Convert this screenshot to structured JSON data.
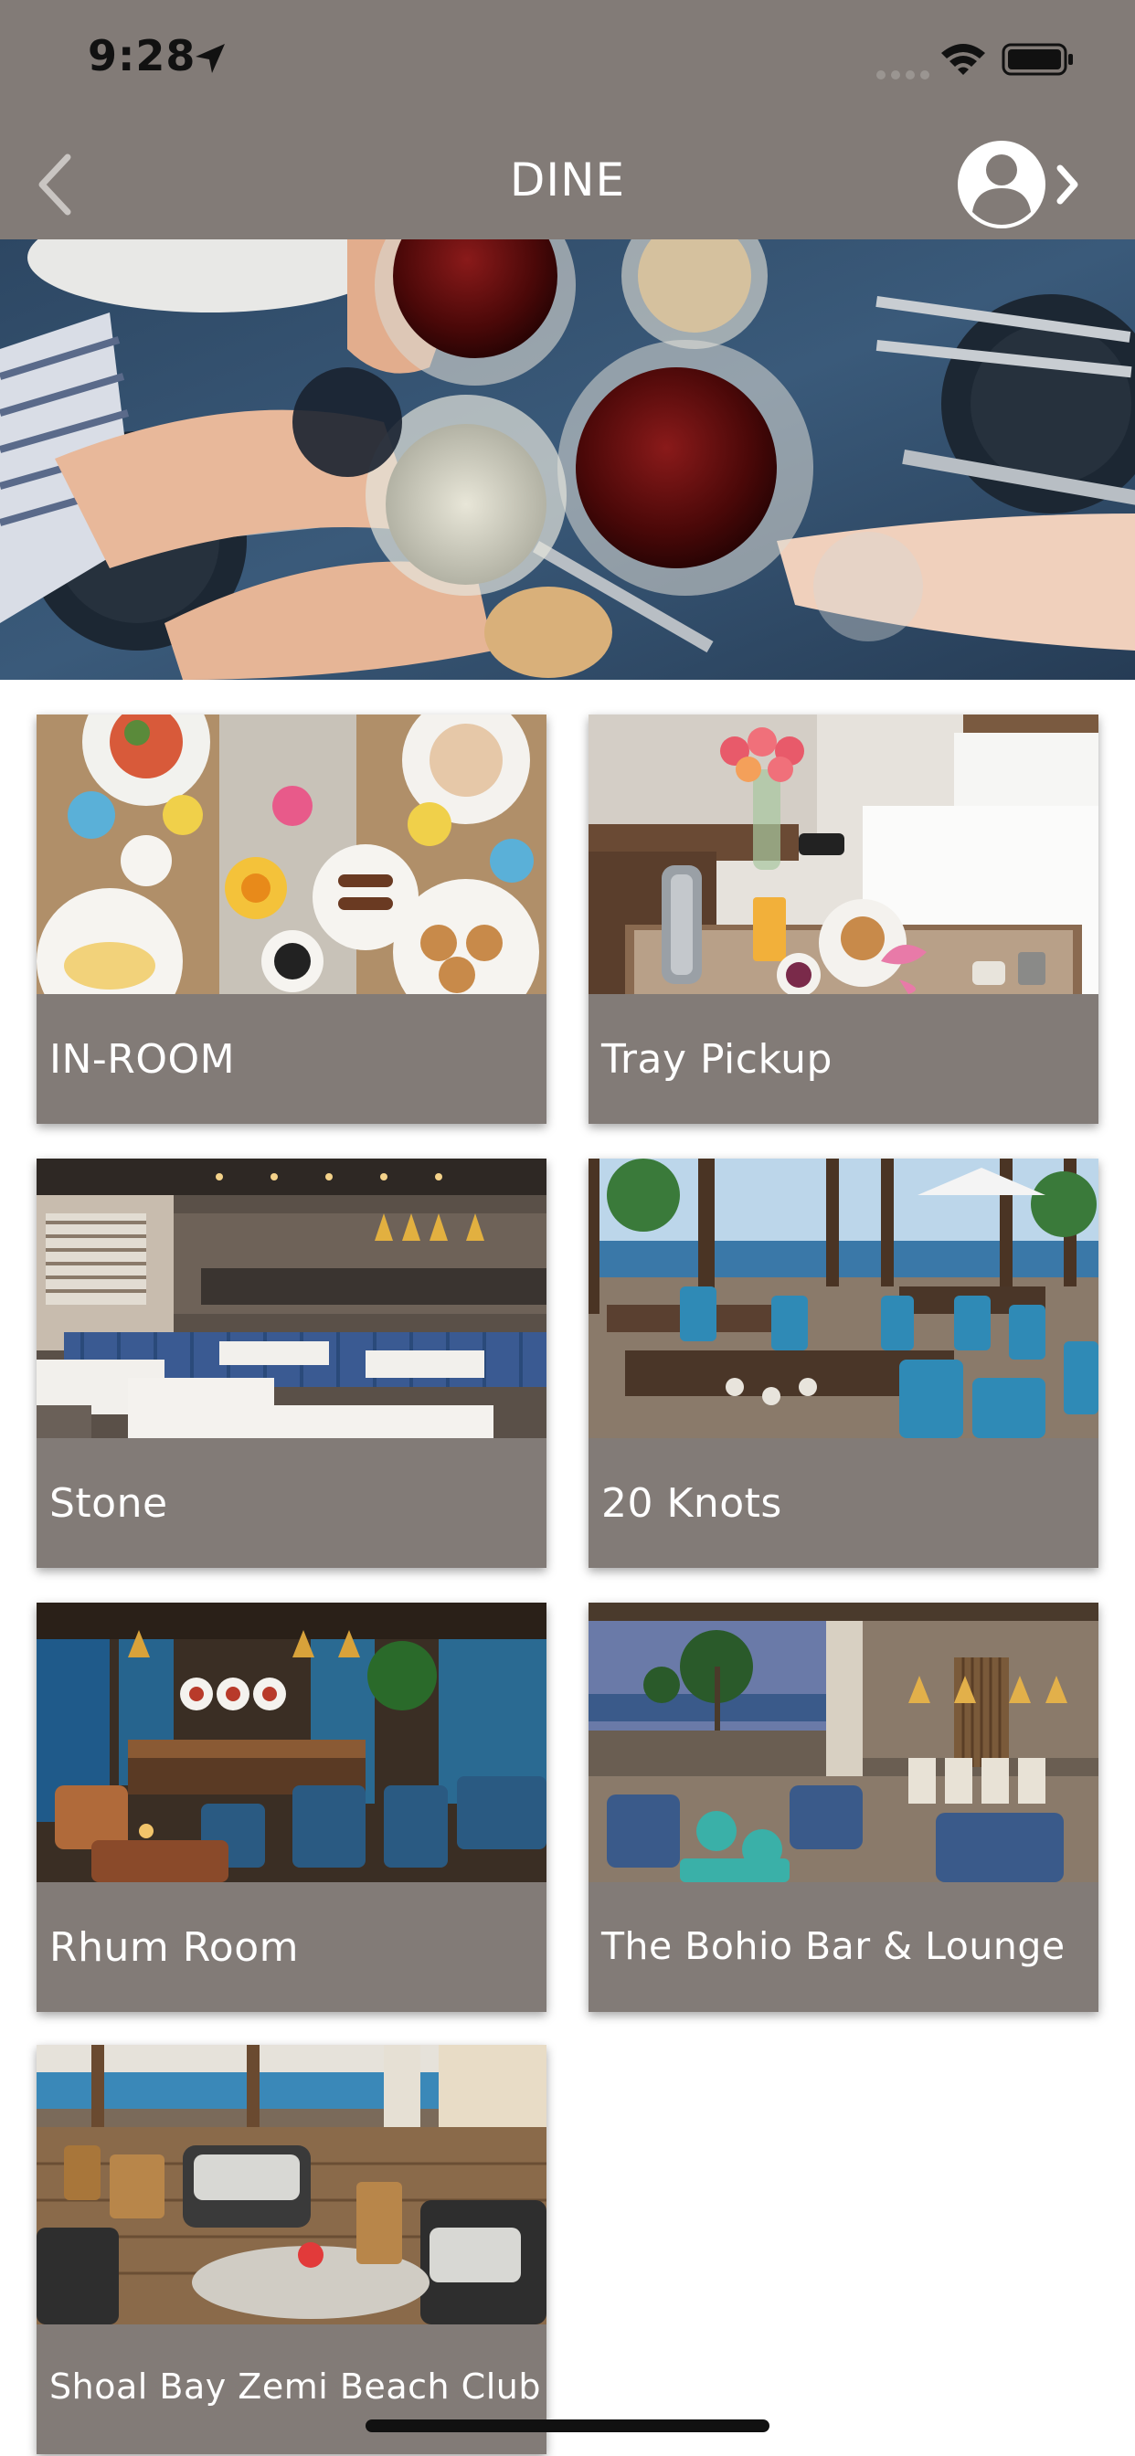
{
  "status_bar": {
    "time": "9:28",
    "icons": [
      "location-arrow-icon",
      "signal-icon",
      "wifi-icon",
      "battery-icon"
    ]
  },
  "nav": {
    "title": "DINE",
    "back_icon": "chevron-left-icon",
    "profile_icon": "user-circle-icon",
    "forward_icon": "chevron-right-icon"
  },
  "hero": {
    "image": "wine-glasses-toast-photo"
  },
  "venues": [
    {
      "label": "IN-ROOM",
      "image": "breakfast-table-photo"
    },
    {
      "label": "Tray Pickup",
      "image": "room-service-tray-photo"
    },
    {
      "label": "Stone",
      "image": "stone-restaurant-photo"
    },
    {
      "label": "20 Knots",
      "image": "20-knots-restaurant-photo"
    },
    {
      "label": "Rhum Room",
      "image": "rhum-room-bar-photo"
    },
    {
      "label": "The Bohio Bar & Lounge",
      "image": "bohio-bar-lounge-photo"
    },
    {
      "label": "Shoal Bay Zemi Beach Club",
      "image": "beach-club-photo"
    }
  ],
  "colors": {
    "bar": "#827b77",
    "card": "#827b77",
    "text_on_bar": "#ffffff",
    "background": "#ffffff"
  }
}
